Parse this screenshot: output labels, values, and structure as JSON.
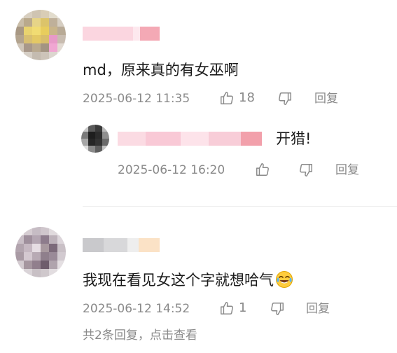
{
  "comments": [
    {
      "text": "md，原来真的有女巫啊",
      "timestamp": "2025-06-12 11:35",
      "like_count": "18",
      "reply_label": "回复",
      "avatar_icon": "blurred-avatar",
      "replies": [
        {
          "text": "开猎!",
          "timestamp": "2025-06-12 16:20",
          "like_count": "",
          "reply_label": "回复",
          "avatar_icon": "blurred-avatar"
        }
      ]
    },
    {
      "text": "我现在看见女这个字就想哈气",
      "emoji": "crying-laughing-emoji",
      "timestamp": "2025-06-12 14:52",
      "like_count": "1",
      "reply_label": "回复",
      "avatar_icon": "blurred-avatar",
      "more_replies": "共2条回复，点击查看"
    }
  ],
  "colors": {
    "text": "#1a1a1a",
    "meta": "#8a8a8a",
    "divider": "#ececec"
  }
}
